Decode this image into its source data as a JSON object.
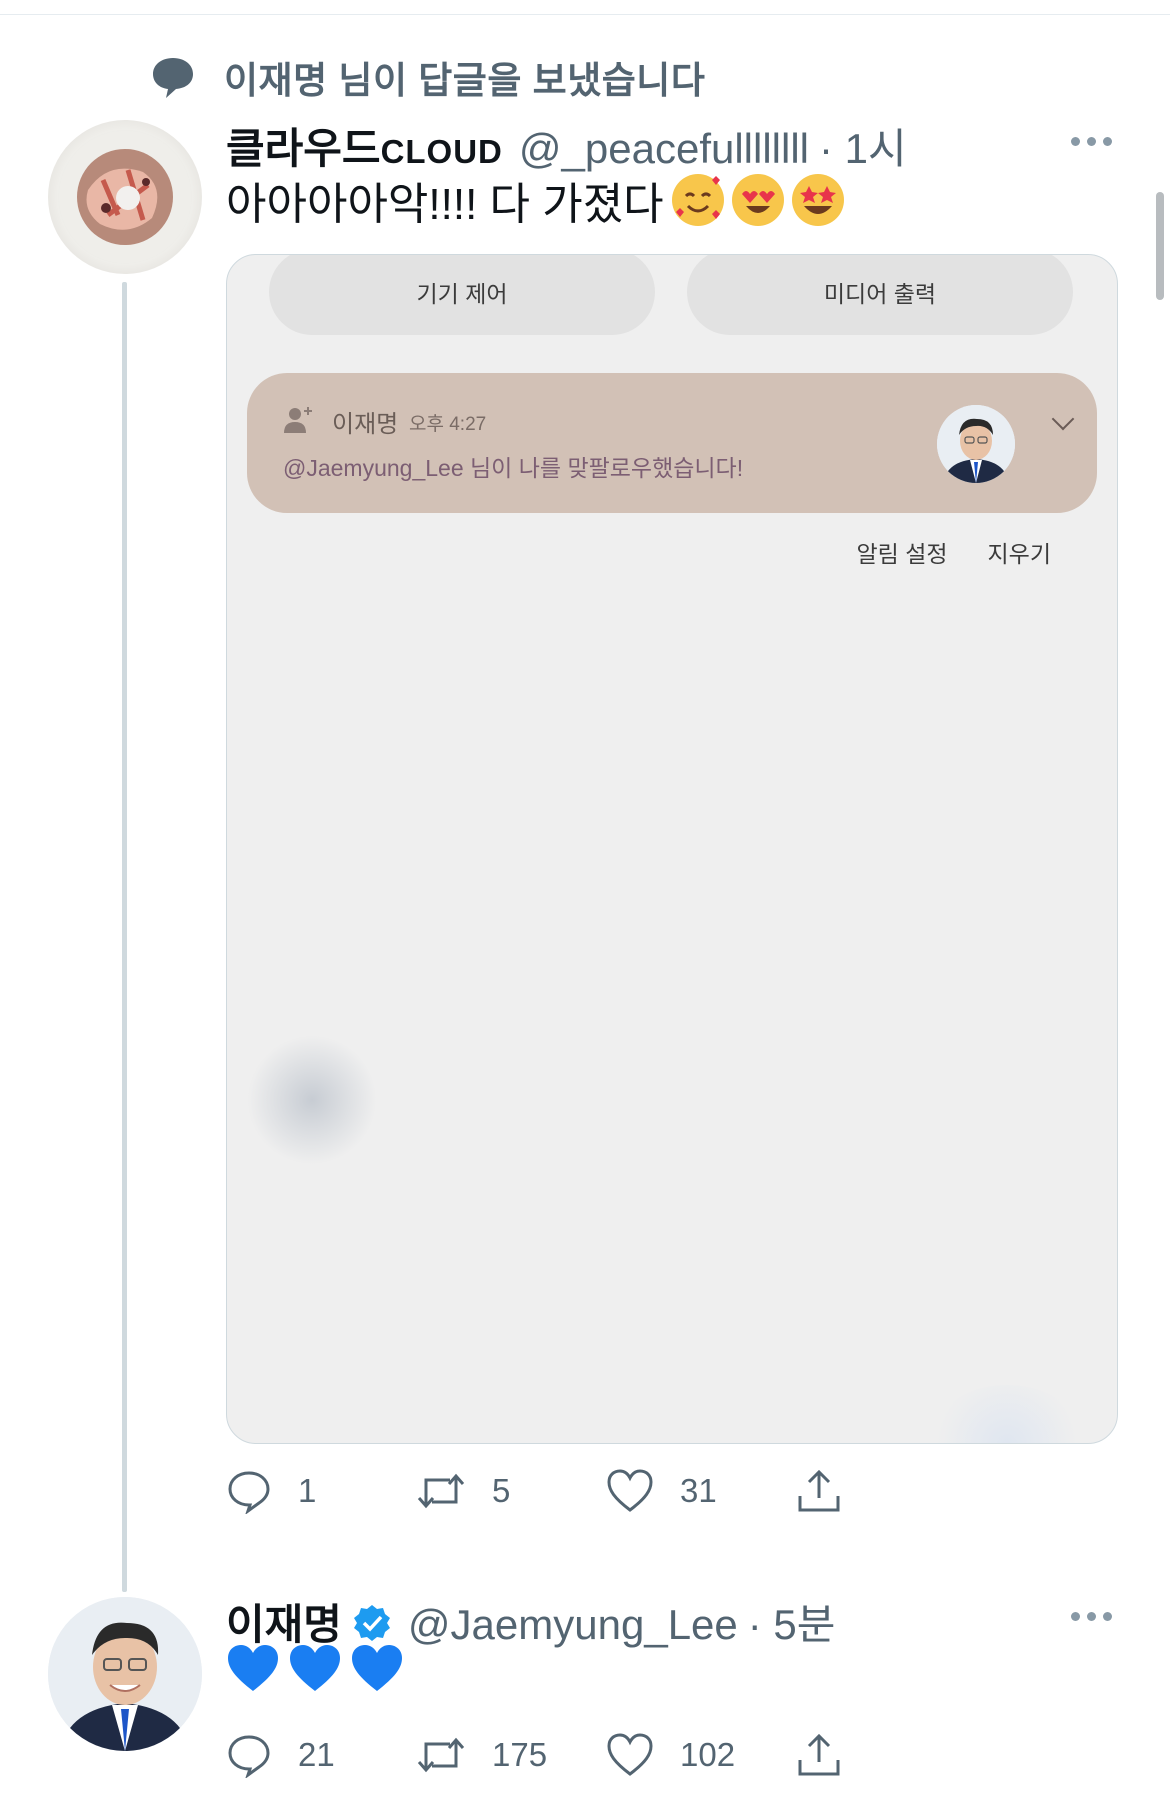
{
  "context": {
    "text": "이재명 님이 답글을 보냈습니다"
  },
  "tweet1": {
    "name": "클라우드",
    "name_smallcaps": "CLOUD",
    "handle": "@_peacefullllllll",
    "time": "· 1시",
    "text": "아아아아악!!!! 다 가졌다",
    "emojis": [
      "smiling-face-with-hearts",
      "heart-eyes",
      "star-struck"
    ],
    "media": {
      "pill_left": "기기 제어",
      "pill_right": "미디어 출력",
      "notification": {
        "name": "이재명",
        "time": "오후 4:27",
        "message": "@Jaemyung_Lee 님이 나를 맞팔로우했습니다!"
      },
      "actions": [
        "알림 설정",
        "지우기"
      ]
    },
    "counts": {
      "reply": "1",
      "retweet": "5",
      "like": "31"
    }
  },
  "tweet2": {
    "name": "이재명",
    "verified": true,
    "handle": "@Jaemyung_Lee",
    "time": "· 5분",
    "text_emojis": [
      "blue-heart",
      "blue-heart",
      "blue-heart"
    ],
    "counts": {
      "reply": "21",
      "retweet": "175",
      "like": "102"
    }
  },
  "colors": {
    "secondary_text": "#536471",
    "notification_bg": "#d2c1b6",
    "verified_blue": "#1d9bf0",
    "blue_heart": "#1a7ef2"
  }
}
